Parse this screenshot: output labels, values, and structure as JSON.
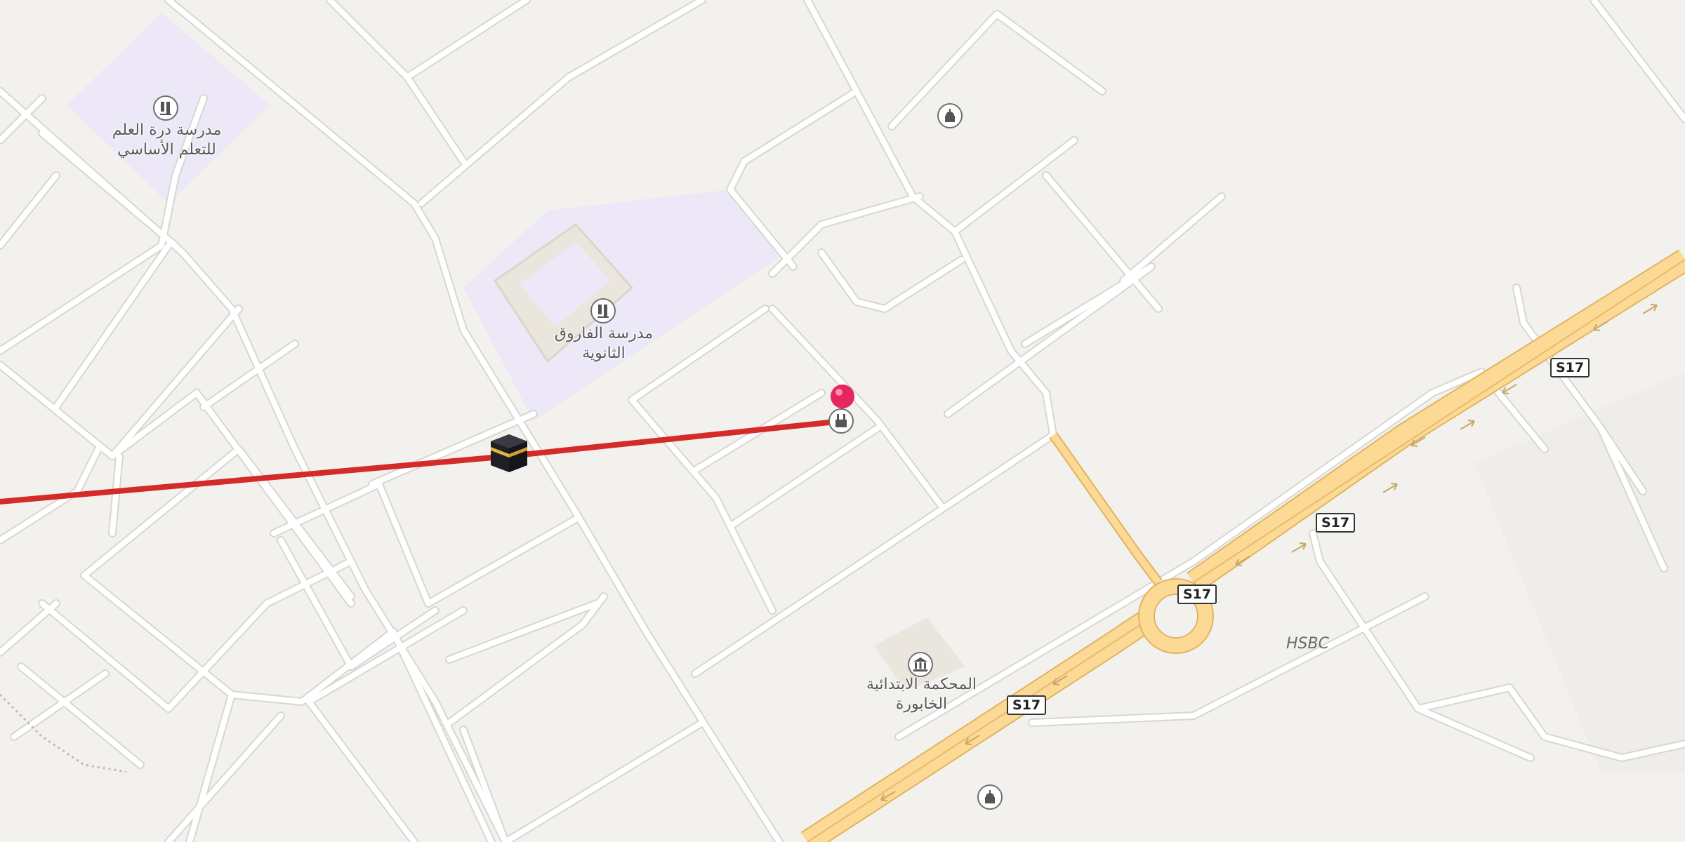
{
  "map": {
    "school_1_name": "مدرسة درة العلم للتعلم الأساسي",
    "school_2_name": "مدرسة الفاروق الثانوية",
    "court_name": "المحكمة الابتدائية الخابورة",
    "hsbc_label": "HSBC",
    "highway_ref": "S17",
    "shield_labels": [
      "S17",
      "S17",
      "S17",
      "S17"
    ],
    "colors": {
      "background": "#f3f1ee",
      "school_area": "#ece8f8",
      "highway": "#fcd995",
      "route_line": "#d42a2a",
      "marker": "#e8265e"
    },
    "icons": {
      "school": "school-icon",
      "mosque": "mosque-icon",
      "courthouse": "courthouse-icon",
      "kaaba": "kaaba-icon",
      "location_pin": "location-pin-icon"
    }
  }
}
